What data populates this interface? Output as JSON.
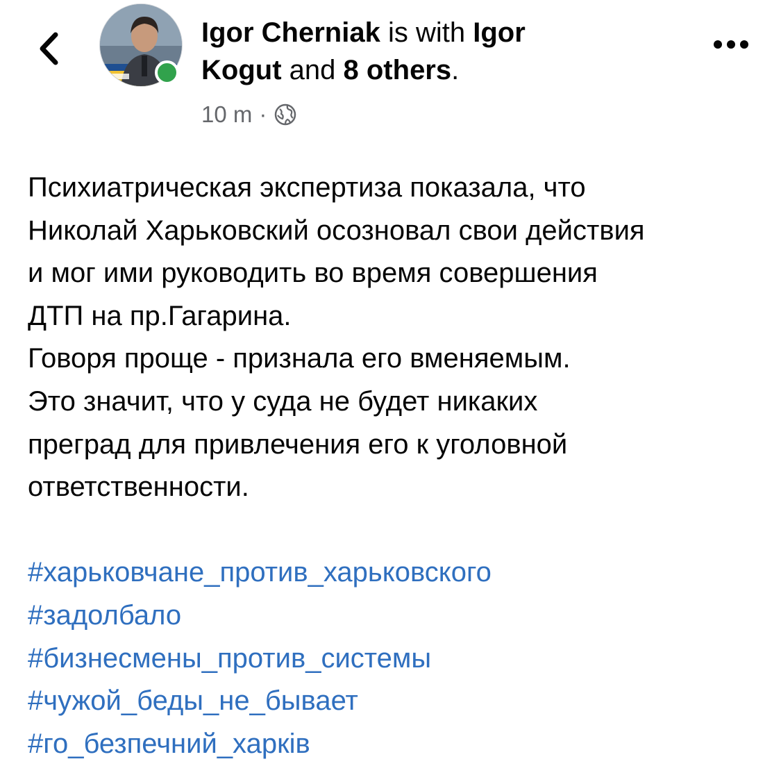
{
  "header": {
    "author": "Igor Cherniak",
    "with_text": "is with",
    "tagged_person_first": "Igor",
    "tagged_person_last": "Kogut",
    "and_text": "and",
    "others": "8 others",
    "period": ".",
    "time": "10 m",
    "separator": "·",
    "privacy_icon": "globe-icon"
  },
  "avatar_icon": "avatar-photo",
  "online_status_color": "#31a24c",
  "post": {
    "lines": [
      "Психиатрическая экспертиза показала, что",
      "Николай Харьковский осозновал свои действия",
      "и мог ими руководить во время совершения",
      "ДТП на пр.Гагарина.",
      "Говоря проще - признала его вменяемым.",
      "Это значит, что у суда не будет никаких",
      "преград для привлечения его к уголовной",
      "ответственности."
    ],
    "hashtags": [
      "#харьковчане_против_харьковского",
      "#задолбало",
      "#бизнесмены_против_системы",
      "#чужой_беды_не_бывает",
      "#го_безпечний_харків"
    ]
  },
  "colors": {
    "hashtag": "#2f6fbf",
    "text": "#050505",
    "meta": "#65676b"
  }
}
